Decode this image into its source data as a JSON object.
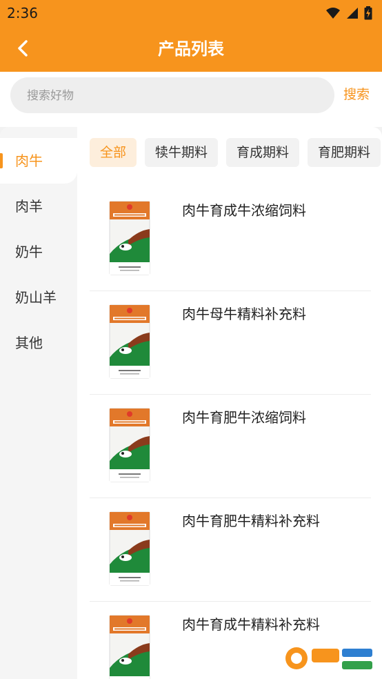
{
  "status_bar": {
    "time": "2:36",
    "icons": [
      "wifi-icon",
      "signal-icon",
      "battery-charging-icon"
    ]
  },
  "header": {
    "title": "产品列表",
    "back_icon": "chevron-left-icon"
  },
  "search": {
    "placeholder": "搜索好物",
    "button_label": "搜索"
  },
  "colors": {
    "accent": "#f7941d",
    "accent_light": "#fdeedc",
    "sidebar_bg": "#f5f5f5",
    "chip_bg": "#f2f2f2"
  },
  "sidebar": {
    "items": [
      {
        "label": "肉牛",
        "active": true
      },
      {
        "label": "肉羊",
        "active": false
      },
      {
        "label": "奶牛",
        "active": false
      },
      {
        "label": "奶山羊",
        "active": false
      },
      {
        "label": "其他",
        "active": false
      }
    ]
  },
  "filters": {
    "chips": [
      {
        "label": "全部",
        "active": true
      },
      {
        "label": "犊牛期料",
        "active": false
      },
      {
        "label": "育成期料",
        "active": false
      },
      {
        "label": "育肥期料",
        "active": false
      }
    ]
  },
  "products": [
    {
      "name": "肉牛育成牛浓缩饲料",
      "image_icon": "feed-bag-icon"
    },
    {
      "name": "肉牛母牛精料补充料",
      "image_icon": "feed-bag-icon"
    },
    {
      "name": "肉牛育肥牛浓缩饲料",
      "image_icon": "feed-bag-icon"
    },
    {
      "name": "肉牛育肥牛精料补充料",
      "image_icon": "feed-bag-icon"
    },
    {
      "name": "肉牛育成牛精料补充料",
      "image_icon": "feed-bag-icon"
    }
  ]
}
